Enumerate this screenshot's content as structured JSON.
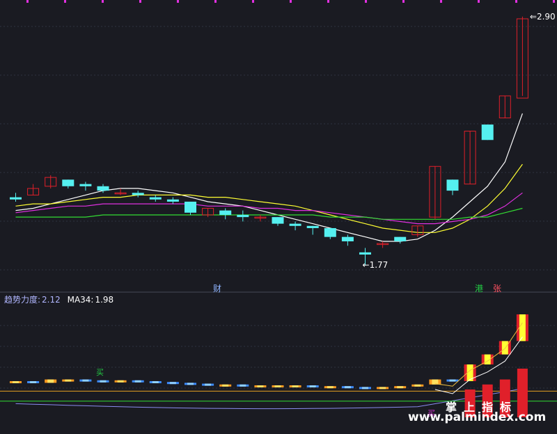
{
  "colors": {
    "bg": "#1a1b22",
    "grid": "#2e3340",
    "divider": "#454a58",
    "up": "#e0202a",
    "down": "#55f0f0",
    "ma_white": "#ffffff",
    "ma_yellow": "#ffff33",
    "ma_magenta": "#e030e0",
    "ma_green": "#33dd33",
    "top_marks": "#e030e0"
  },
  "main_panel": {
    "price_high_label": "2.90",
    "price_low_label": "1.77",
    "low_arrow": "←",
    "event_labels": [
      {
        "text": "财",
        "color": "#8fb4ff"
      },
      {
        "text": "港",
        "color": "#22cc44"
      },
      {
        "text": "张",
        "color": "#ff5060"
      }
    ]
  },
  "indicator_panel": {
    "legend_label": "趋势力度:",
    "legend_value": "2.12",
    "ma_label": "MA34:",
    "ma_value": "1.98",
    "signals": [
      {
        "text": "买",
        "color": "#22cc44"
      },
      {
        "text": "买",
        "color": "#e030e0"
      }
    ]
  },
  "watermark": {
    "cn": "掌上指标",
    "url": "www.palmindex.com"
  },
  "chart_data": {
    "type": "candlestick",
    "title": "",
    "xlabel": "",
    "ylabel": "",
    "ylim": [
      1.7,
      2.95
    ],
    "candles": [
      {
        "o": 2.08,
        "h": 2.1,
        "l": 2.06,
        "c": 2.07
      },
      {
        "o": 2.09,
        "h": 2.14,
        "l": 2.09,
        "c": 2.12
      },
      {
        "o": 2.13,
        "h": 2.18,
        "l": 2.12,
        "c": 2.17
      },
      {
        "o": 2.16,
        "h": 2.16,
        "l": 2.12,
        "c": 2.13
      },
      {
        "o": 2.14,
        "h": 2.15,
        "l": 2.11,
        "c": 2.13
      },
      {
        "o": 2.13,
        "h": 2.14,
        "l": 2.1,
        "c": 2.11
      },
      {
        "o": 2.1,
        "h": 2.12,
        "l": 2.09,
        "c": 2.1
      },
      {
        "o": 2.1,
        "h": 2.11,
        "l": 2.08,
        "c": 2.09
      },
      {
        "o": 2.08,
        "h": 2.09,
        "l": 2.06,
        "c": 2.07
      },
      {
        "o": 2.07,
        "h": 2.08,
        "l": 2.05,
        "c": 2.06
      },
      {
        "o": 2.06,
        "h": 2.06,
        "l": 2.0,
        "c": 2.01
      },
      {
        "o": 2.0,
        "h": 2.03,
        "l": 1.99,
        "c": 2.03
      },
      {
        "o": 2.02,
        "h": 2.03,
        "l": 1.98,
        "c": 2.0
      },
      {
        "o": 2.0,
        "h": 2.02,
        "l": 1.97,
        "c": 1.99
      },
      {
        "o": 1.99,
        "h": 2.0,
        "l": 1.97,
        "c": 1.99
      },
      {
        "o": 1.99,
        "h": 1.99,
        "l": 1.95,
        "c": 1.96
      },
      {
        "o": 1.96,
        "h": 1.97,
        "l": 1.93,
        "c": 1.95
      },
      {
        "o": 1.95,
        "h": 1.95,
        "l": 1.91,
        "c": 1.94
      },
      {
        "o": 1.94,
        "h": 1.94,
        "l": 1.89,
        "c": 1.9
      },
      {
        "o": 1.9,
        "h": 1.91,
        "l": 1.86,
        "c": 1.88
      },
      {
        "o": 1.83,
        "h": 1.85,
        "l": 1.77,
        "c": 1.82
      },
      {
        "o": 1.87,
        "h": 1.88,
        "l": 1.85,
        "c": 1.87
      },
      {
        "o": 1.9,
        "h": 1.9,
        "l": 1.87,
        "c": 1.88
      },
      {
        "o": 1.91,
        "h": 1.95,
        "l": 1.9,
        "c": 1.95
      },
      {
        "o": 1.99,
        "h": 2.22,
        "l": 1.98,
        "c": 2.22
      },
      {
        "o": 2.16,
        "h": 2.16,
        "l": 2.09,
        "c": 2.11
      },
      {
        "o": 2.14,
        "h": 2.38,
        "l": 2.14,
        "c": 2.38
      },
      {
        "o": 2.41,
        "h": 2.41,
        "l": 2.34,
        "c": 2.34
      },
      {
        "o": 2.44,
        "h": 2.54,
        "l": 2.44,
        "c": 2.54
      },
      {
        "o": 2.53,
        "h": 2.9,
        "l": 2.54,
        "c": 2.89
      }
    ],
    "series": [
      {
        "values": [
          2.02,
          2.03,
          2.05,
          2.07,
          2.09,
          2.11,
          2.12,
          2.12,
          2.11,
          2.1,
          2.08,
          2.06,
          2.05,
          2.04,
          2.02,
          2.0,
          1.98,
          1.96,
          1.94,
          1.92,
          1.9,
          1.88,
          1.88,
          1.89,
          1.93,
          1.99,
          2.06,
          2.13,
          2.24,
          2.46
        ]
      },
      {
        "values": [
          2.04,
          2.05,
          2.05,
          2.06,
          2.07,
          2.08,
          2.08,
          2.09,
          2.09,
          2.09,
          2.09,
          2.08,
          2.08,
          2.07,
          2.06,
          2.05,
          2.04,
          2.02,
          2.0,
          1.98,
          1.96,
          1.94,
          1.93,
          1.92,
          1.92,
          1.94,
          1.98,
          2.04,
          2.12,
          2.23
        ]
      },
      {
        "values": [
          2.01,
          2.02,
          2.03,
          2.04,
          2.04,
          2.05,
          2.05,
          2.05,
          2.05,
          2.05,
          2.05,
          2.04,
          2.04,
          2.04,
          2.03,
          2.03,
          2.02,
          2.02,
          2.01,
          2.0,
          1.99,
          1.98,
          1.97,
          1.96,
          1.96,
          1.97,
          1.98,
          2.0,
          2.04,
          2.1
        ]
      },
      {
        "values": [
          1.99,
          1.99,
          1.99,
          1.99,
          1.99,
          2.0,
          2.0,
          2.0,
          2.0,
          2.0,
          2.0,
          2.0,
          2.0,
          2.0,
          2.0,
          2.0,
          2.0,
          2.0,
          1.99,
          1.99,
          1.99,
          1.98,
          1.98,
          1.98,
          1.98,
          1.98,
          1.99,
          1.99,
          2.01,
          2.03
        ]
      }
    ],
    "indicator": {
      "type": "bar",
      "ylim": [
        1.7,
        3.0
      ],
      "trend_strength": [
        2.1,
        2.08,
        2.12,
        2.12,
        2.11,
        2.1,
        2.11,
        2.1,
        2.09,
        2.08,
        2.07,
        2.06,
        2.06,
        2.05,
        2.05,
        2.05,
        2.05,
        2.04,
        2.04,
        2.03,
        2.02,
        2.03,
        2.04,
        2.06,
        2.12,
        2.1,
        2.3,
        2.42,
        2.58,
        2.9
      ],
      "ma34": [
        1.98,
        1.98,
        1.98,
        1.98,
        1.98,
        1.98,
        1.98,
        1.98,
        1.98,
        1.98,
        1.98,
        1.98,
        1.98,
        1.98,
        1.98,
        1.98,
        1.98,
        1.98,
        1.98,
        1.98,
        1.98,
        1.98,
        1.98,
        1.98,
        1.98,
        1.98,
        1.98,
        1.98,
        1.98,
        1.98
      ]
    }
  }
}
